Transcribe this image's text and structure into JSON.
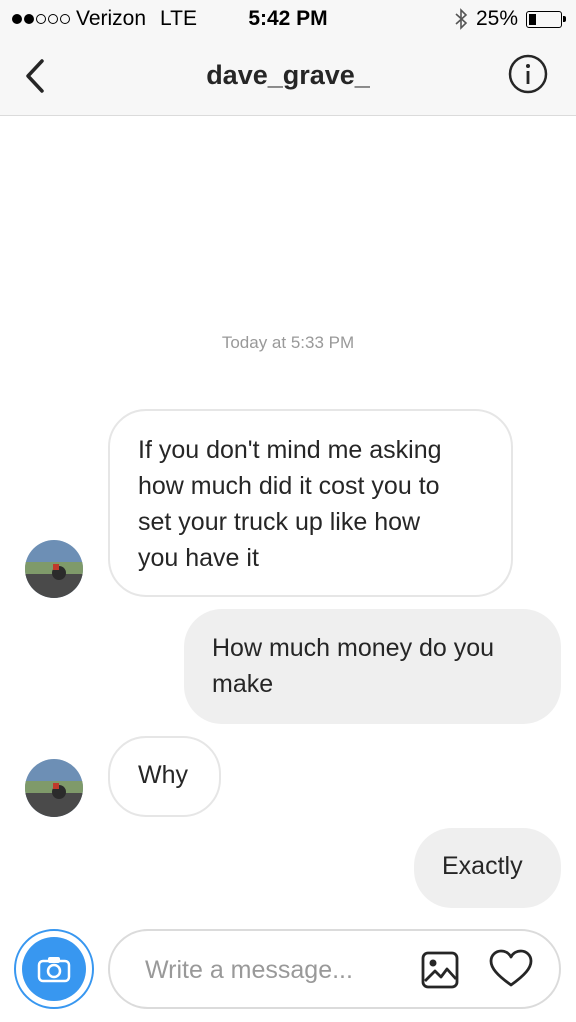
{
  "status_bar": {
    "carrier": "Verizon",
    "network": "LTE",
    "time": "5:42 PM",
    "battery": "25%",
    "battery_level": 0.25,
    "icons": [
      "signal-dots-icon",
      "bluetooth-icon",
      "battery-icon"
    ]
  },
  "header": {
    "title": "dave_grave_",
    "icons": [
      "back-chevron-icon",
      "info-icon"
    ]
  },
  "conversation": {
    "timestamp": "Today at 5:33 PM",
    "messages": [
      {
        "direction": "incoming",
        "lines": [
          "If you don't mind me asking",
          "how much did it cost you to",
          "set your truck up like how",
          "you have it"
        ]
      },
      {
        "direction": "outgoing",
        "lines": [
          "How much money do you",
          "make"
        ]
      },
      {
        "direction": "incoming",
        "lines": [
          "Why"
        ]
      },
      {
        "direction": "outgoing",
        "lines": [
          "Exactly"
        ]
      }
    ]
  },
  "composer": {
    "placeholder": "Write a message...",
    "value": "",
    "icons": [
      "camera-icon",
      "gallery-icon",
      "heart-icon"
    ]
  },
  "colors": {
    "accent": "#3897f0",
    "outgoing_bubble": "#efefef",
    "incoming_border": "#e6e6e6",
    "header_bg": "#f7f7f7"
  }
}
